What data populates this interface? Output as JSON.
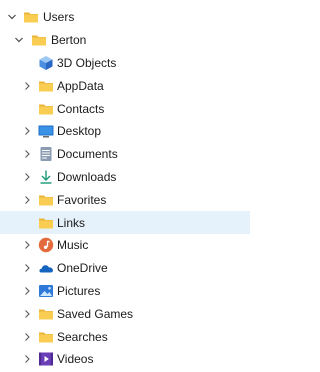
{
  "tree": {
    "root": {
      "label": "Users",
      "icon": "folder-icon",
      "expanded": true
    },
    "user": {
      "label": "Berton",
      "icon": "folder-icon",
      "expanded": true
    },
    "children": [
      {
        "label": "3D Objects",
        "icon": "3d-objects-icon",
        "has_children": false,
        "selected": false
      },
      {
        "label": "AppData",
        "icon": "folder-icon",
        "has_children": true,
        "selected": false
      },
      {
        "label": "Contacts",
        "icon": "folder-icon",
        "has_children": false,
        "selected": false
      },
      {
        "label": "Desktop",
        "icon": "desktop-icon",
        "has_children": true,
        "selected": false
      },
      {
        "label": "Documents",
        "icon": "documents-icon",
        "has_children": true,
        "selected": false
      },
      {
        "label": "Downloads",
        "icon": "downloads-icon",
        "has_children": true,
        "selected": false
      },
      {
        "label": "Favorites",
        "icon": "folder-icon",
        "has_children": true,
        "selected": false
      },
      {
        "label": "Links",
        "icon": "folder-icon",
        "has_children": false,
        "selected": true
      },
      {
        "label": "Music",
        "icon": "music-icon",
        "has_children": true,
        "selected": false
      },
      {
        "label": "OneDrive",
        "icon": "onedrive-icon",
        "has_children": true,
        "selected": false
      },
      {
        "label": "Pictures",
        "icon": "pictures-icon",
        "has_children": true,
        "selected": false
      },
      {
        "label": "Saved Games",
        "icon": "folder-icon",
        "has_children": true,
        "selected": false
      },
      {
        "label": "Searches",
        "icon": "folder-icon",
        "has_children": true,
        "selected": false
      },
      {
        "label": "Videos",
        "icon": "videos-icon",
        "has_children": true,
        "selected": false
      }
    ],
    "colors": {
      "selected_bg": "#e5f1fb",
      "folder": "#f6c646",
      "chevron": "#5a5a5a"
    }
  }
}
